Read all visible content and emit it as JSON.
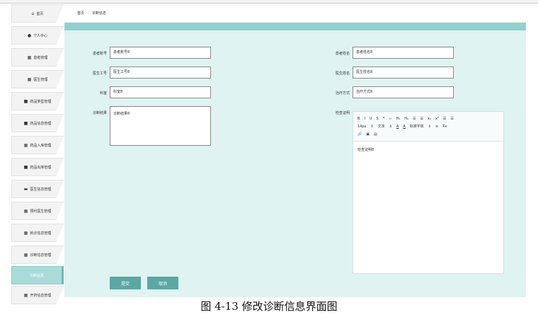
{
  "sidebar": {
    "items": [
      {
        "label": "首页",
        "icon": "home-icon",
        "glyph": "⌂"
      },
      {
        "label": "个人中心",
        "icon": "user-icon",
        "glyph": "●"
      },
      {
        "label": "患者管理",
        "icon": "grid-icon",
        "glyph": "▦"
      },
      {
        "label": "医生管理",
        "icon": "grid-icon",
        "glyph": "▦"
      },
      {
        "label": "药品类型管理",
        "icon": "bag-icon",
        "glyph": "■"
      },
      {
        "label": "药品信息管理",
        "icon": "file-icon",
        "glyph": "■"
      },
      {
        "label": "药品入库管理",
        "icon": "table-icon",
        "glyph": "▦"
      },
      {
        "label": "药品出库管理",
        "icon": "doc-icon",
        "glyph": "■"
      },
      {
        "label": "医生信息管理",
        "icon": "card-icon",
        "glyph": "▬"
      },
      {
        "label": "预约医生管理",
        "icon": "grid-icon",
        "glyph": "▦"
      },
      {
        "label": "就诊信息管理",
        "icon": "grid-icon",
        "glyph": "▦"
      },
      {
        "label": "诊断信息管理",
        "icon": "grid-icon",
        "glyph": "▦"
      },
      {
        "label": "诊断信息",
        "icon": "",
        "glyph": ""
      },
      {
        "label": "开药信息管理",
        "icon": "grid-icon",
        "glyph": "▦"
      }
    ]
  },
  "breadcrumb": {
    "home": "首页",
    "sep": "⋮",
    "current": "诊断信息"
  },
  "form": {
    "patient_account_label": "患者账号",
    "patient_account_value": "患者账号8",
    "patient_name_label": "患者姓名",
    "patient_name_value": "患者姓名8",
    "doctor_id_label": "医生工号",
    "doctor_id_value": "医生工号8",
    "doctor_name_label": "医生姓名",
    "doctor_name_value": "医生姓名8",
    "department_label": "科室",
    "department_value": "科室8",
    "treatment_label": "治疗方式",
    "treatment_value": "治疗方式8",
    "diagnosis_label": "诊断结果",
    "diagnosis_value": "诊断结果8",
    "evidence_label": "检查证明",
    "evidence_value": "检查证明8"
  },
  "editor_toolbar": {
    "row1": [
      "B",
      "I",
      "U",
      "S",
      "❞",
      "‹›",
      "H₁",
      "H₂",
      "☰",
      "☰",
      "x₂",
      "x²",
      "☰",
      "☰"
    ],
    "font_size": "14px",
    "font_size_arrow": "⇕",
    "text_style": "文本",
    "text_style_arrow": "⇕",
    "color_a": "A",
    "bg_a": "A",
    "title_font": "标准字体",
    "title_font_arrow": "⇕",
    "align": "≡",
    "clear": "T̶x",
    "row3": [
      "🔗",
      "▣",
      "▤"
    ]
  },
  "buttons": {
    "submit": "提交",
    "cancel": "取消"
  },
  "caption": "图 4-13 修改诊断信息界面图"
}
